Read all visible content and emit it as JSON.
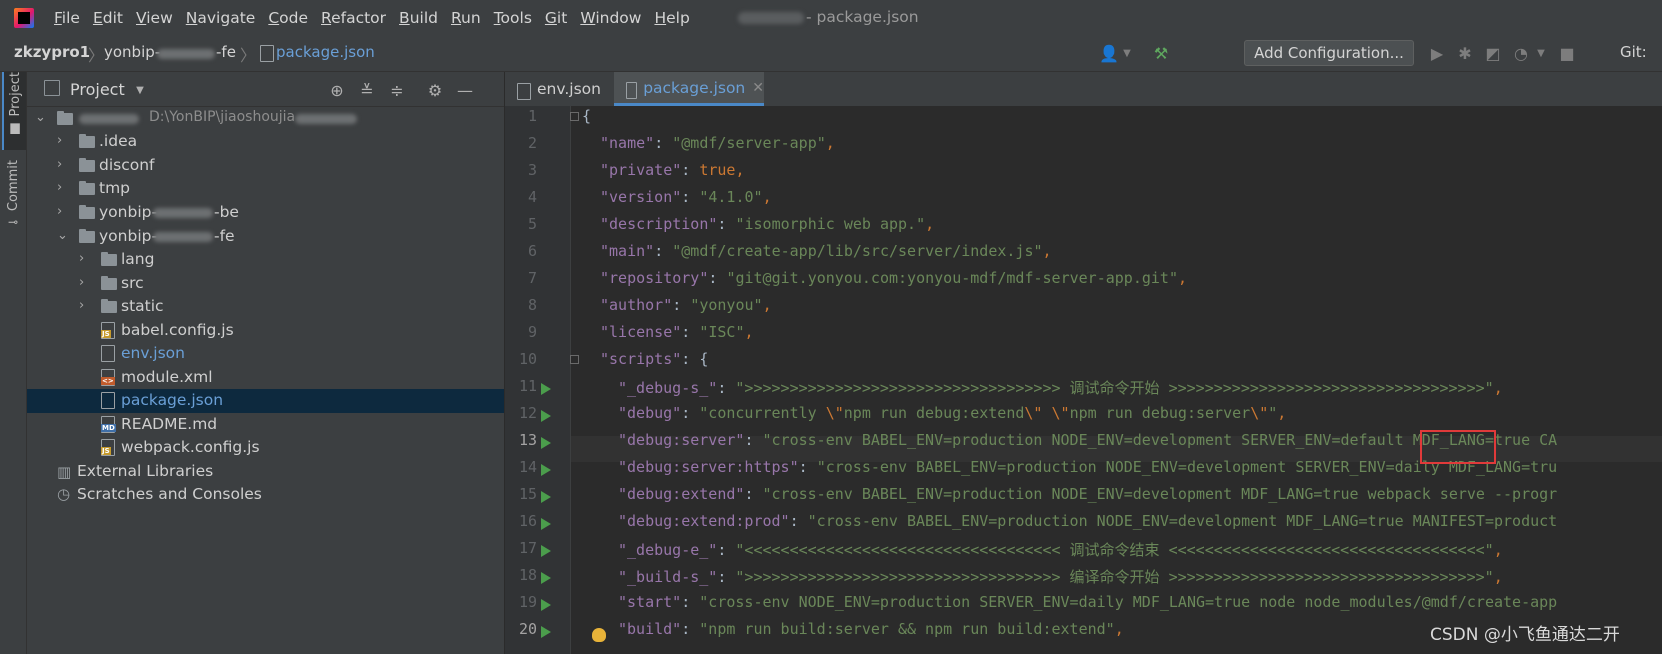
{
  "menu": [
    "File",
    "Edit",
    "View",
    "Navigate",
    "Code",
    "Refactor",
    "Build",
    "Run",
    "Tools",
    "Git",
    "Window",
    "Help"
  ],
  "window_title": "- package.json",
  "breadcrumbs": {
    "project": "zkzypro1",
    "module_prefix": "yonbip-",
    "module_suffix": "-fe",
    "file": "package.json"
  },
  "toolbar": {
    "add_configuration": "Add Configuration...",
    "git_label": "Git:"
  },
  "stripe": {
    "project": "Project",
    "commit": "Commit"
  },
  "project_panel": {
    "title": "Project"
  },
  "tree": [
    {
      "label": "",
      "path": "D:\\YonBIP\\jiaoshoujia",
      "kind": "root"
    },
    {
      "label": ".idea",
      "kind": "folder"
    },
    {
      "label": "disconf",
      "kind": "folder"
    },
    {
      "label": "tmp",
      "kind": "folder"
    },
    {
      "label": "yonbip-",
      "suffix": "-be",
      "kind": "folder"
    },
    {
      "label": "yonbip-",
      "suffix": "-fe",
      "kind": "folder-open"
    },
    {
      "label": "lang",
      "kind": "folder"
    },
    {
      "label": "src",
      "kind": "folder"
    },
    {
      "label": "static",
      "kind": "folder"
    },
    {
      "label": "babel.config.js",
      "kind": "js"
    },
    {
      "label": "env.json",
      "kind": "json"
    },
    {
      "label": "module.xml",
      "kind": "xml"
    },
    {
      "label": "package.json",
      "kind": "json"
    },
    {
      "label": "README.md",
      "kind": "md"
    },
    {
      "label": "webpack.config.js",
      "kind": "js"
    },
    {
      "label": "External Libraries",
      "kind": "lib"
    },
    {
      "label": "Scratches and Consoles",
      "kind": "scratch"
    }
  ],
  "tabs": [
    {
      "label": "env.json",
      "active": false
    },
    {
      "label": "package.json",
      "active": true
    }
  ],
  "line_numbers": [
    "1",
    "2",
    "3",
    "4",
    "5",
    "6",
    "7",
    "8",
    "9",
    "10",
    "11",
    "12",
    "13",
    "14",
    "15",
    "16",
    "17",
    "18",
    "19",
    "20"
  ],
  "code": {
    "l1": "{",
    "l2k": "\"name\"",
    "l2v": "\"@mdf/server-app\"",
    "l3k": "\"private\"",
    "l3v": "true",
    "l4k": "\"version\"",
    "l4v": "\"4.1.0\"",
    "l5k": "\"description\"",
    "l5v": "\"isomorphic web app.\"",
    "l6k": "\"main\"",
    "l6v": "\"@mdf/create-app/lib/src/server/index.js\"",
    "l7k": "\"repository\"",
    "l7v": "\"git@git.yonyou.com:yonyou-mdf/mdf-server-app.git\"",
    "l8k": "\"author\"",
    "l8v": "\"yonyou\"",
    "l9k": "\"license\"",
    "l9v": "\"ISC\"",
    "l10k": "\"scripts\"",
    "l10v": "{",
    "l11k": "\"_debug-s_\"",
    "l11v": "\">>>>>>>>>>>>>>>>>>>>>>>>>>>>>>>>>>> 调试命令开始 >>>>>>>>>>>>>>>>>>>>>>>>>>>>>>>>>>>\"",
    "l12k": "\"debug\"",
    "l12a": "\"concurrently ",
    "l12b": "\\\"",
    "l12c": "npm run debug:extend",
    "l12d": "\\\"",
    "l12e": " ",
    "l12f": "\\\"",
    "l12g": "npm run debug:server",
    "l12h": "\\\"",
    "l12i": "\"",
    "l13k": "\"debug:server\"",
    "l13v": "\"cross-env BABEL_ENV=production NODE_ENV=development SERVER_ENV=default MDF_LANG=true CA",
    "l14k": "\"debug:server:https\"",
    "l14v": "\"cross-env BABEL_ENV=production NODE_ENV=development SERVER_ENV=daily MDF_LANG=tru",
    "l15k": "\"debug:extend\"",
    "l15v": "\"cross-env BABEL_ENV=production NODE_ENV=development MDF_LANG=true webpack serve --progr",
    "l16k": "\"debug:extend:prod\"",
    "l16v": "\"cross-env BABEL_ENV=production NODE_ENV=development MDF_LANG=true MANIFEST=product",
    "l17k": "\"_debug-e_\"",
    "l17v": "\"<<<<<<<<<<<<<<<<<<<<<<<<<<<<<<<<<<< 调试命令结束 <<<<<<<<<<<<<<<<<<<<<<<<<<<<<<<<<<<\"",
    "l18k": "\"_build-s_\"",
    "l18v": "\">>>>>>>>>>>>>>>>>>>>>>>>>>>>>>>>>>> 编译命令开始 >>>>>>>>>>>>>>>>>>>>>>>>>>>>>>>>>>>\"",
    "l19k": "\"start\"",
    "l19v": "\"cross-env NODE_ENV=production SERVER_ENV=daily MDF_LANG=true node node_modules/@mdf/create-app",
    "l20k": "\"build\"",
    "l20v": "\"npm run build:server && npm run build:extend\""
  },
  "watermark": "CSDN @小飞鱼通达二开",
  "colors": {
    "accent": "#4a88c7",
    "highlight_box": "#e03a3a",
    "run": "#4b9d4c"
  }
}
